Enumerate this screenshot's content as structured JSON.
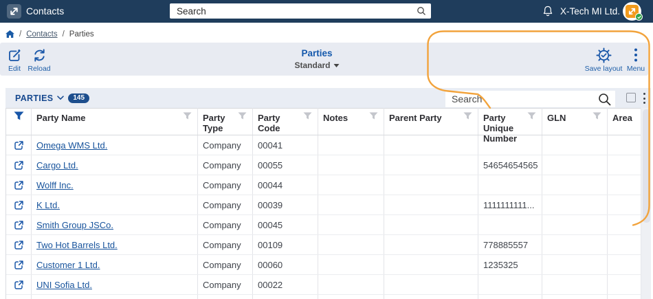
{
  "navbar": {
    "title": "Contacts",
    "search_placeholder": "Search",
    "account_name": "X-Tech MI Ltd."
  },
  "breadcrumb": {
    "separator": "/",
    "items": [
      {
        "label": "Contacts"
      },
      {
        "label": "Parties"
      }
    ]
  },
  "toolbar": {
    "edit_label": "Edit",
    "reload_label": "Reload",
    "view_title": "Parties",
    "view_subtitle": "Standard",
    "save_layout_label": "Save layout",
    "menu_label": "Menu"
  },
  "panel": {
    "title": "PARTIES",
    "count": "145",
    "search_placeholder": "Search"
  },
  "table": {
    "columns": [
      {
        "label": ""
      },
      {
        "label": "Party Name"
      },
      {
        "label": "Party Type"
      },
      {
        "label": "Party Code"
      },
      {
        "label": "Notes"
      },
      {
        "label": "Parent Party"
      },
      {
        "label": "Party Unique Number"
      },
      {
        "label": "GLN"
      },
      {
        "label": "Area"
      }
    ],
    "rows": [
      {
        "party_name": "Omega WMS Ltd.",
        "party_type": "Company",
        "party_code": "00041",
        "notes": "",
        "parent_party": "",
        "party_unique_number": "",
        "gln": "",
        "area": ""
      },
      {
        "party_name": "Cargo Ltd.",
        "party_type": "Company",
        "party_code": "00055",
        "notes": "",
        "parent_party": "",
        "party_unique_number": "54654654565",
        "gln": "",
        "area": ""
      },
      {
        "party_name": "Wolff Inc.",
        "party_type": "Company",
        "party_code": "00044",
        "notes": "",
        "parent_party": "",
        "party_unique_number": "",
        "gln": "",
        "area": ""
      },
      {
        "party_name": "K Ltd.",
        "party_type": "Company",
        "party_code": "00039",
        "notes": "",
        "parent_party": "",
        "party_unique_number": "1111111111...",
        "gln": "",
        "area": ""
      },
      {
        "party_name": "Smith Group JSCo.",
        "party_type": "Company",
        "party_code": "00045",
        "notes": "",
        "parent_party": "",
        "party_unique_number": "",
        "gln": "",
        "area": ""
      },
      {
        "party_name": "Two Hot Barrels Ltd.",
        "party_type": "Company",
        "party_code": "00109",
        "notes": "",
        "parent_party": "",
        "party_unique_number": "778885557",
        "gln": "",
        "area": ""
      },
      {
        "party_name": "Customer 1 Ltd.",
        "party_type": "Company",
        "party_code": "00060",
        "notes": "",
        "parent_party": "",
        "party_unique_number": "1235325",
        "gln": "",
        "area": ""
      },
      {
        "party_name": "UNI Sofia Ltd.",
        "party_type": "Company",
        "party_code": "00022",
        "notes": "",
        "parent_party": "",
        "party_unique_number": "",
        "gln": "",
        "area": ""
      }
    ]
  },
  "icons": {
    "app_logo": "swap-diagonal-arrows",
    "notifications": "bell",
    "avatar_status": "green-check",
    "breadcrumb_home": "home",
    "edit": "pencil-square",
    "reload": "refresh-arrows",
    "save_layout": "gear-check",
    "menu": "kebab-vertical",
    "panel_caret": "chevron-down",
    "search": "magnifier",
    "column_filter": "funnel",
    "active_filter": "funnel-filled-blue",
    "row_open": "external-link",
    "window_mode": "square-outline"
  },
  "colors": {
    "navbar_navy": "#1f3d5c",
    "accent_blue": "#1856a8",
    "title_blue": "#1559ac",
    "link_blue": "#17539c",
    "badge_navy": "#1d4e8d",
    "toolbar_bg": "#e8ebf2",
    "panel_header_bg": "#e9edf4",
    "annotation_orange": "#f2a33c"
  }
}
